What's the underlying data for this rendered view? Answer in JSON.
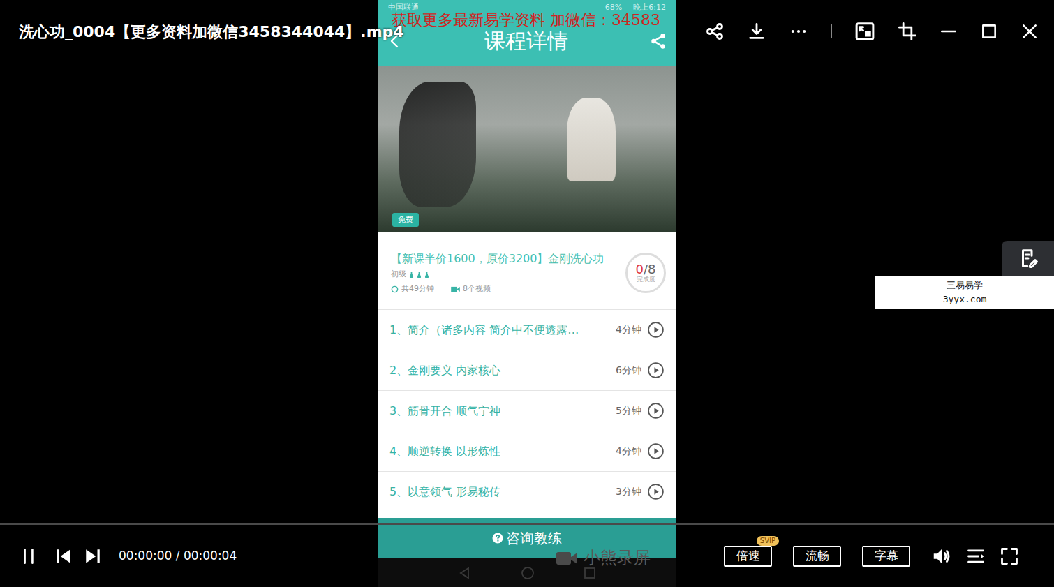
{
  "window": {
    "title": "洗心功_0004【更多资料加微信3458344044】.mp4"
  },
  "phone": {
    "status_bar": {
      "carrier": "中国联通",
      "battery": "68%",
      "time": "晚上6:12"
    },
    "watermark": "获取更多最新易学资料 加微信：34583",
    "header": {
      "title": "课程详情"
    },
    "banner": {
      "badge": "免费"
    },
    "course": {
      "title": "【新课半价1600，原价3200】金刚洗心功",
      "level": "初级",
      "duration": "共49分钟",
      "videos": "8个视频",
      "progress": {
        "done": "0",
        "total": "/8",
        "label": "完成度"
      }
    },
    "lessons": [
      {
        "title": "1、简介（诸多内容 简介中不便透露…",
        "duration": "4分钟"
      },
      {
        "title": "2、金刚要义 内家核心",
        "duration": "6分钟"
      },
      {
        "title": "3、筋骨开合 顺气宁神",
        "duration": "5分钟"
      },
      {
        "title": "4、顺逆转换 以形炼性",
        "duration": "4分钟"
      },
      {
        "title": "5、以意领气 形易秘传",
        "duration": "3分钟"
      }
    ],
    "consult_button": "咨询教练",
    "recorder_watermark": "小熊录屏"
  },
  "site_badge": {
    "name": "三易易学",
    "url": "3yyx.com"
  },
  "player": {
    "playing": true,
    "level": 0,
    "time": "00:00:00 / 00:00:04",
    "buttons": [
      {
        "label": "倍速",
        "badge": "SVIP"
      },
      {
        "label": "流畅",
        "badge": ""
      },
      {
        "label": "字幕",
        "badge": ""
      }
    ]
  }
}
